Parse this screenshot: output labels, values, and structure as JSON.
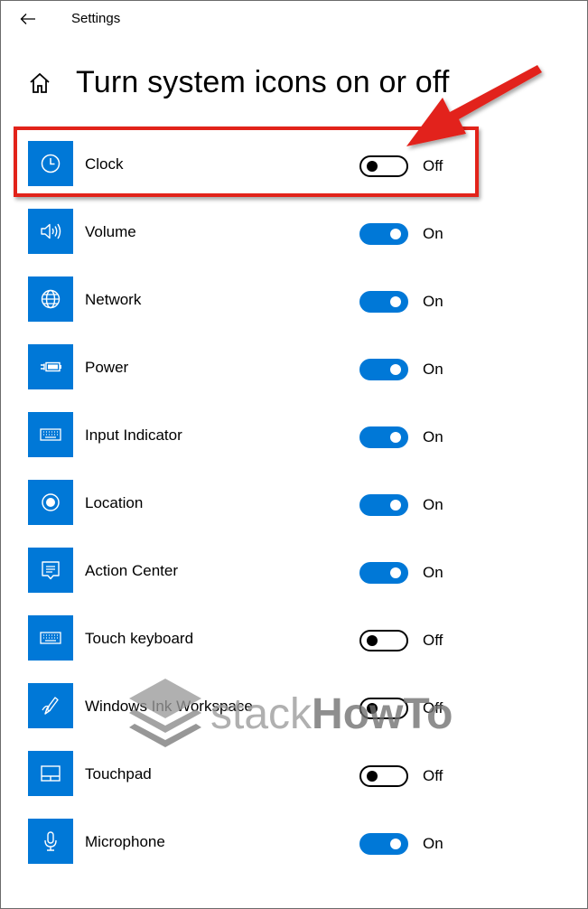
{
  "window": {
    "title": "Settings"
  },
  "page": {
    "title": "Turn system icons on or off"
  },
  "items": [
    {
      "label": "Clock",
      "icon": "clock-icon",
      "state": "Off",
      "on": false
    },
    {
      "label": "Volume",
      "icon": "volume-icon",
      "state": "On",
      "on": true
    },
    {
      "label": "Network",
      "icon": "network-globe-icon",
      "state": "On",
      "on": true
    },
    {
      "label": "Power",
      "icon": "battery-icon",
      "state": "On",
      "on": true
    },
    {
      "label": "Input Indicator",
      "icon": "keyboard-icon",
      "state": "On",
      "on": true
    },
    {
      "label": "Location",
      "icon": "location-icon",
      "state": "On",
      "on": true
    },
    {
      "label": "Action Center",
      "icon": "action-center-icon",
      "state": "On",
      "on": true
    },
    {
      "label": "Touch keyboard",
      "icon": "keyboard-icon",
      "state": "Off",
      "on": false
    },
    {
      "label": "Windows Ink Workspace",
      "icon": "pen-icon",
      "state": "Off",
      "on": false
    },
    {
      "label": "Touchpad",
      "icon": "touchpad-icon",
      "state": "Off",
      "on": false
    },
    {
      "label": "Microphone",
      "icon": "microphone-icon",
      "state": "On",
      "on": true
    }
  ],
  "watermark": {
    "word1": "stack",
    "word2": "HowTo"
  },
  "colors": {
    "accent": "#0078d7",
    "annotation": "#e2231a"
  }
}
